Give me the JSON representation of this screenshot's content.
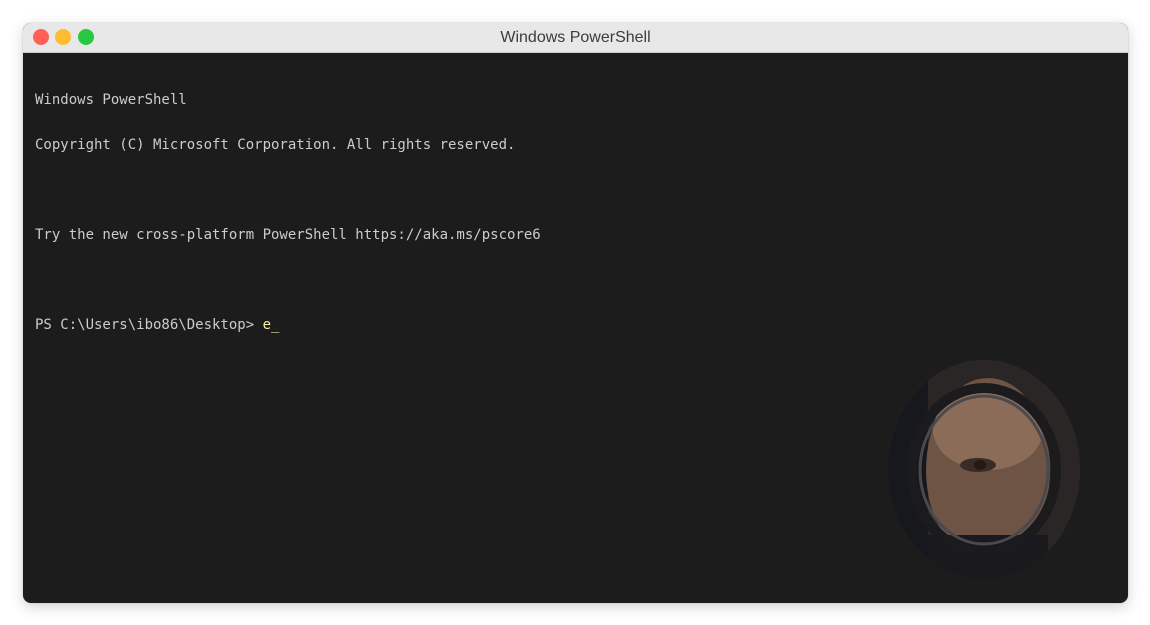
{
  "window": {
    "title": "Windows PowerShell"
  },
  "terminal": {
    "lines": [
      "Windows PowerShell",
      "Copyright (C) Microsoft Corporation. All rights reserved.",
      "",
      "Try the new cross-platform PowerShell https://aka.ms/pscore6",
      ""
    ],
    "prompt": "PS C:\\Users\\ibo86\\Desktop> ",
    "typed_command": "e_"
  },
  "colors": {
    "terminal_bg": "#1c1c1c",
    "terminal_text": "#cccccc",
    "command_text": "#f9f1a5",
    "titlebar_bg": "#e8e8e8",
    "close": "#fe5f57",
    "minimize": "#febc2e",
    "maximize": "#28c840"
  },
  "overlay": {
    "icon": "webcam-overlay-icon"
  }
}
